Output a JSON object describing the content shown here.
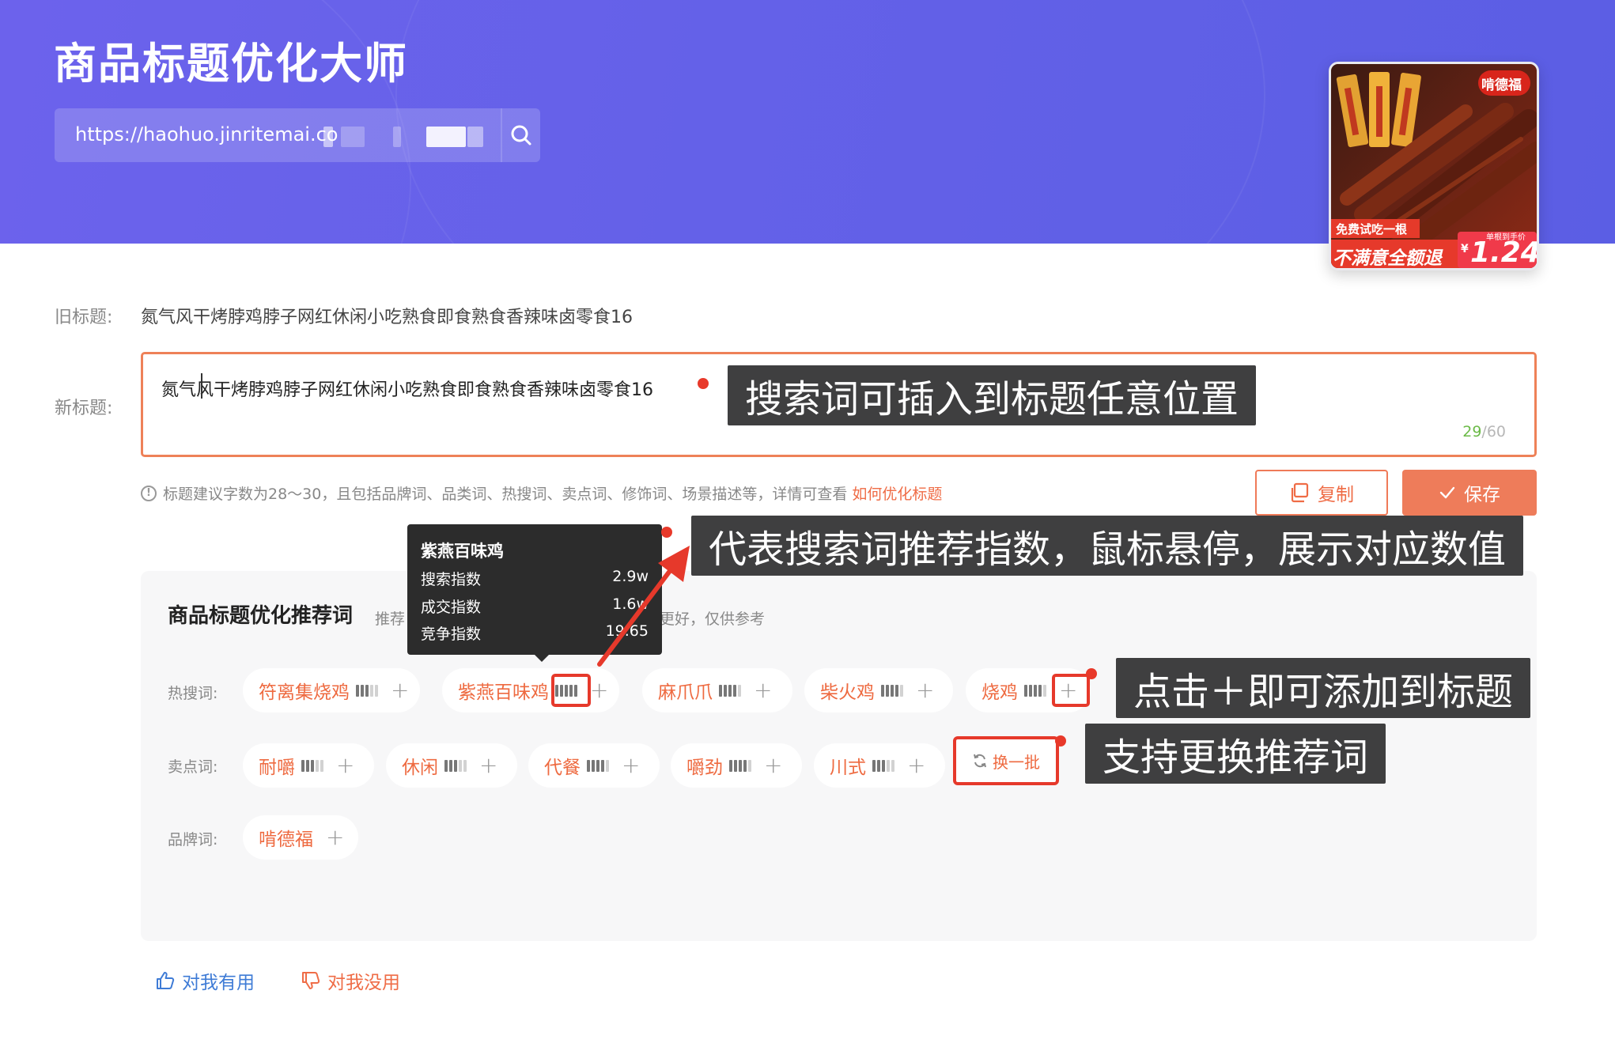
{
  "app": {
    "title": "商品标题优化大师",
    "url_value": "https://haohuo.jinritemai.co"
  },
  "thumbnail": {
    "brand": "啃德福",
    "promo": "免费试吃一根",
    "slogan": "不满意全额退",
    "price_label": "单根到手价",
    "price_symbol": "¥",
    "price": "1.24"
  },
  "titles": {
    "old_label": "旧标题:",
    "old_value": "氮气风干烤脖鸡脖子网红休闲小吃熟食即食熟食香辣味卤零食16",
    "new_label": "新标题:",
    "new_value": "氮气风干烤脖鸡脖子网红休闲小吃熟食即食熟食香辣味卤零食16",
    "count_current": "29",
    "count_max": "/60"
  },
  "hint": {
    "text": "标题建议字数为28～30，且包括品牌词、品类词、热搜词、卖点词、修饰词、场景描述等，详情可查看",
    "link": "如何优化标题"
  },
  "actions": {
    "copy": "复制",
    "save": "保存"
  },
  "panel": {
    "title": "商品标题优化推荐词",
    "subtitle_a": "推荐",
    "subtitle_b": "能更好，仅供参考",
    "rows": {
      "hot_label": "热搜词:",
      "hot": [
        {
          "word": "符离集烧鸡",
          "level": 3
        },
        {
          "word": "紫燕百味鸡",
          "level": 5
        },
        {
          "word": "麻爪爪",
          "level": 4
        },
        {
          "word": "柴火鸡",
          "level": 4
        },
        {
          "word": "烧鸡",
          "level": 4
        }
      ],
      "selling_label": "卖点词:",
      "selling": [
        {
          "word": "耐嚼",
          "level": 3
        },
        {
          "word": "休闲",
          "level": 3
        },
        {
          "word": "代餐",
          "level": 4
        },
        {
          "word": "嚼劲",
          "level": 4
        },
        {
          "word": "川式",
          "level": 3
        }
      ],
      "brand_label": "品牌词:",
      "brand": [
        {
          "word": "啃德福"
        }
      ]
    },
    "refresh": "换一批"
  },
  "tooltip": {
    "title": "紫燕百味鸡",
    "rows": [
      {
        "label": "搜索指数",
        "value": "2.9w"
      },
      {
        "label": "成交指数",
        "value": "1.6w"
      },
      {
        "label": "竞争指数",
        "value": "19.65"
      }
    ]
  },
  "callouts": {
    "insert": "搜索词可插入到标题任意位置",
    "index": "代表搜索词推荐指数，鼠标悬停，展示对应数值",
    "add": "点击＋即可添加到标题",
    "swap": "支持更换推荐词"
  },
  "feedback": {
    "useful": "对我有用",
    "useless": "对我没用"
  },
  "colors": {
    "header": "#6461e8",
    "accent": "#ee6a40",
    "annotation": "#e6392b",
    "callout_bg": "#3f3f40"
  },
  "icons": [
    "search-icon",
    "copy-icon",
    "check-icon",
    "info-icon",
    "refresh-icon",
    "thumbs-up-icon",
    "thumbs-down-icon",
    "plus-icon"
  ]
}
